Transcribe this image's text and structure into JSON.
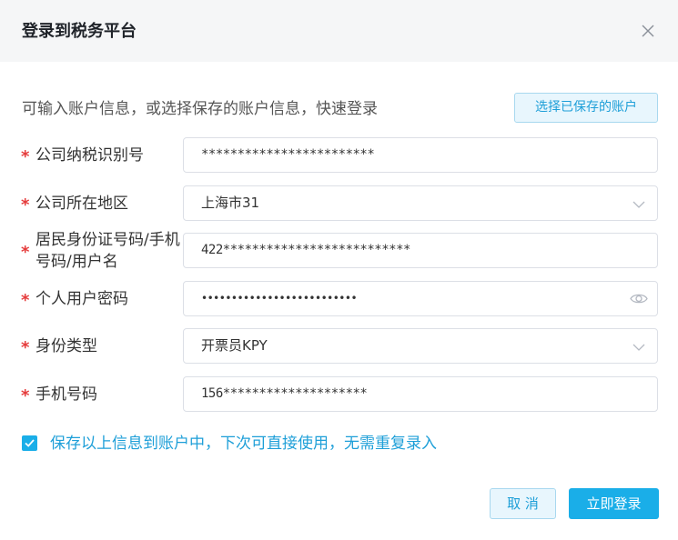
{
  "dialog": {
    "title": "登录到税务平台",
    "close_icon": "close-icon"
  },
  "hint": {
    "text": "可输入账户信息，或选择保存的账户信息，快速登录",
    "saved_accounts_button": "选择已保存的账户"
  },
  "form": {
    "required_mark": "*",
    "fields": [
      {
        "label": "公司纳税识别号",
        "value": "************************",
        "kind": "input"
      },
      {
        "label": "公司所在地区",
        "value": "上海市31",
        "kind": "select"
      },
      {
        "label": "居民身份证号码/手机号码/用户名",
        "value": "422**************************",
        "kind": "input"
      },
      {
        "label": "个人用户密码",
        "value": "••••••••••••••••••••••••••",
        "kind": "password"
      },
      {
        "label": "身份类型",
        "value": "开票员KPY",
        "kind": "select"
      },
      {
        "label": "手机号码",
        "value": "156********************",
        "kind": "input"
      }
    ]
  },
  "save_option": {
    "checked": true,
    "label": "保存以上信息到账户中，下次可直接使用，无需重复录入"
  },
  "footer": {
    "cancel_label": "取 消",
    "login_label": "立即登录"
  },
  "colors": {
    "accent": "#1aaee8",
    "required": "#e53b3b",
    "header_bg": "#f5f6f7"
  }
}
